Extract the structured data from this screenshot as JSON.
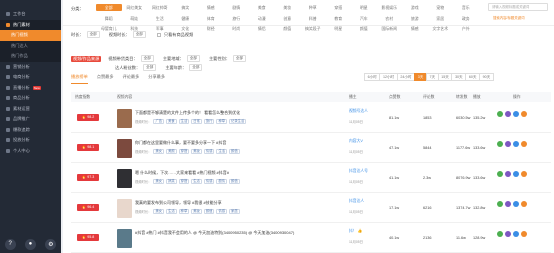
{
  "sidebar": {
    "items": [
      {
        "label": "工作台"
      },
      {
        "label": "热门素材"
      },
      {
        "label": "热门视频"
      },
      {
        "label": "热门达人"
      },
      {
        "label": "热门作品"
      },
      {
        "label": "营销分析"
      },
      {
        "label": "电商分析"
      },
      {
        "label": "直播分析",
        "badge": "New"
      },
      {
        "label": "商品分析"
      },
      {
        "label": "素材运营"
      },
      {
        "label": "品牌推广"
      },
      {
        "label": "爆款追踪"
      },
      {
        "label": "投放分析"
      },
      {
        "label": "个人中心"
      }
    ]
  },
  "categories": {
    "label": "分类：",
    "row1": [
      "全部",
      "网红美女",
      "网红帅哥",
      "搞笑",
      "情感",
      "剧情",
      "美食",
      "美妆",
      "种草",
      "穿搭",
      "明星",
      "影视娱乐",
      "游戏",
      "宠物",
      "音乐"
    ],
    "row2": [
      "舞蹈",
      "萌娃",
      "生活",
      "健康",
      "体育",
      "旅行",
      "动漫",
      "创意",
      "科普",
      "教育",
      "汽车",
      "农村",
      "旅游",
      "家居",
      "政务"
    ],
    "row3": [
      "母婴育儿",
      "科技",
      "军事",
      "文化",
      "财经",
      "时尚",
      "情侣",
      "颜值",
      "搞笑段子",
      "明星",
      "颜值",
      "国际新闻",
      "情感",
      "文字艺术",
      "户外"
    ],
    "active_index": 0
  },
  "search": {
    "placeholder": "请输入视频标题或关键词",
    "option": "搜索内容/标题关键词"
  },
  "filters": {
    "row1": {
      "label": "时长：",
      "select1": "全部",
      "label2": "视频时长：",
      "select2": "全部",
      "checkbox_label": "只看有商品视频"
    },
    "row2": {
      "tag": "视频/作品来源",
      "label1": "视频带货类目：",
      "select1": "全部",
      "label2": "主要地域：",
      "select2": "全部",
      "label3": "主要性别：",
      "select3": "全部"
    },
    "row3": {
      "label1": "达人粉丝数：",
      "select1": "全部",
      "label2": "主要年龄：",
      "select2": "全部"
    }
  },
  "tabs": [
    {
      "label": "播放榜单",
      "active": true
    },
    {
      "label": "点赞最多",
      "active": false
    },
    {
      "label": "评论最多",
      "active": false
    },
    {
      "label": "分享最多",
      "active": false
    }
  ],
  "time_range": {
    "options": [
      "6小时",
      "12小时",
      "24小时",
      "3天",
      "7天",
      "15天",
      "30天",
      "60天",
      "90天"
    ],
    "active_index": 3
  },
  "table": {
    "headers": [
      "热度指数",
      "视频内容",
      "播主",
      "点赞数",
      "评论数",
      "转发数",
      "播放",
      "操作"
    ],
    "rows": [
      {
        "score": "98.2",
        "title": "下面都是不够清楚的文件上传多个的！ 看看怎么整合到优化",
        "tags": [
          "视频时长：",
          "广告",
          "美食",
          "生活",
          "日常",
          "旅行",
          "种草",
          "记录生活"
        ],
        "author": "视频号达人",
        "date": "11月05日",
        "likes": "81.1w",
        "comments": "1853",
        "shares": "6030.5w",
        "plays": "135.2w",
        "thumb": "#9a6b4d"
      },
      {
        "score": "98.1",
        "title": "你门都在这里要做什么事，要不要多分享一下 #抖音",
        "tags": [
          "视频时长：",
          "美女",
          "美颜",
          "穿搭",
          "美妆",
          "情感",
          "生活",
          "颜值"
        ],
        "author": "内容大V",
        "date": "11月05日",
        "likes": "47.1w",
        "comments": "5844",
        "shares": "1177.6w",
        "plays": "133.6w",
        "thumb": "#7c4a3e"
      },
      {
        "score": "97.3",
        "title": "嗯 什么时候，下次……大家来看看 #热门视频 #抖音#",
        "tags": [
          "视频时长：",
          "美女",
          "搞笑",
          "穿搭",
          "生活",
          "情感",
          "剧情",
          "颜值"
        ],
        "author": "抖音达人号",
        "date": "11月05日",
        "likes": "41.1w",
        "comments": "2.3w",
        "shares": "8076.9w",
        "plays": "133.6w",
        "thumb": "#2f2f33"
      },
      {
        "score": "96.4",
        "title": "我真的要发布到公司领导，领导 #我很 #技能分享",
        "tags": [
          "视频时长：",
          "美女",
          "生活",
          "种草",
          "美妆",
          "颜值",
          "情感",
          "家居"
        ],
        "author": "抖音达人",
        "date": "11月05日",
        "likes": "17.1w",
        "comments": "6216",
        "shares": "1374.7w",
        "plays": "132.8w",
        "thumb": "#e8d7cc"
      },
      {
        "score": "95.8",
        "title": "#抖音 #热门 #抖音我不会用的人 @ 今天加油特别(3400950235) @ 今天加油(3400930047)",
        "tags": [],
        "author": "抖！ 👍",
        "date": "11月05日",
        "likes": "40.1w",
        "comments": "2136",
        "shares": "11.6w",
        "plays": "128.9w",
        "thumb": "#5a7a8a"
      }
    ]
  },
  "colors": {
    "accent": "#f08a2c",
    "hot": "#e4393c",
    "sidebar": "#232a36",
    "link": "#3a8ee6"
  },
  "bottom_icons": [
    "help-icon",
    "wechat-icon",
    "settings-icon"
  ]
}
